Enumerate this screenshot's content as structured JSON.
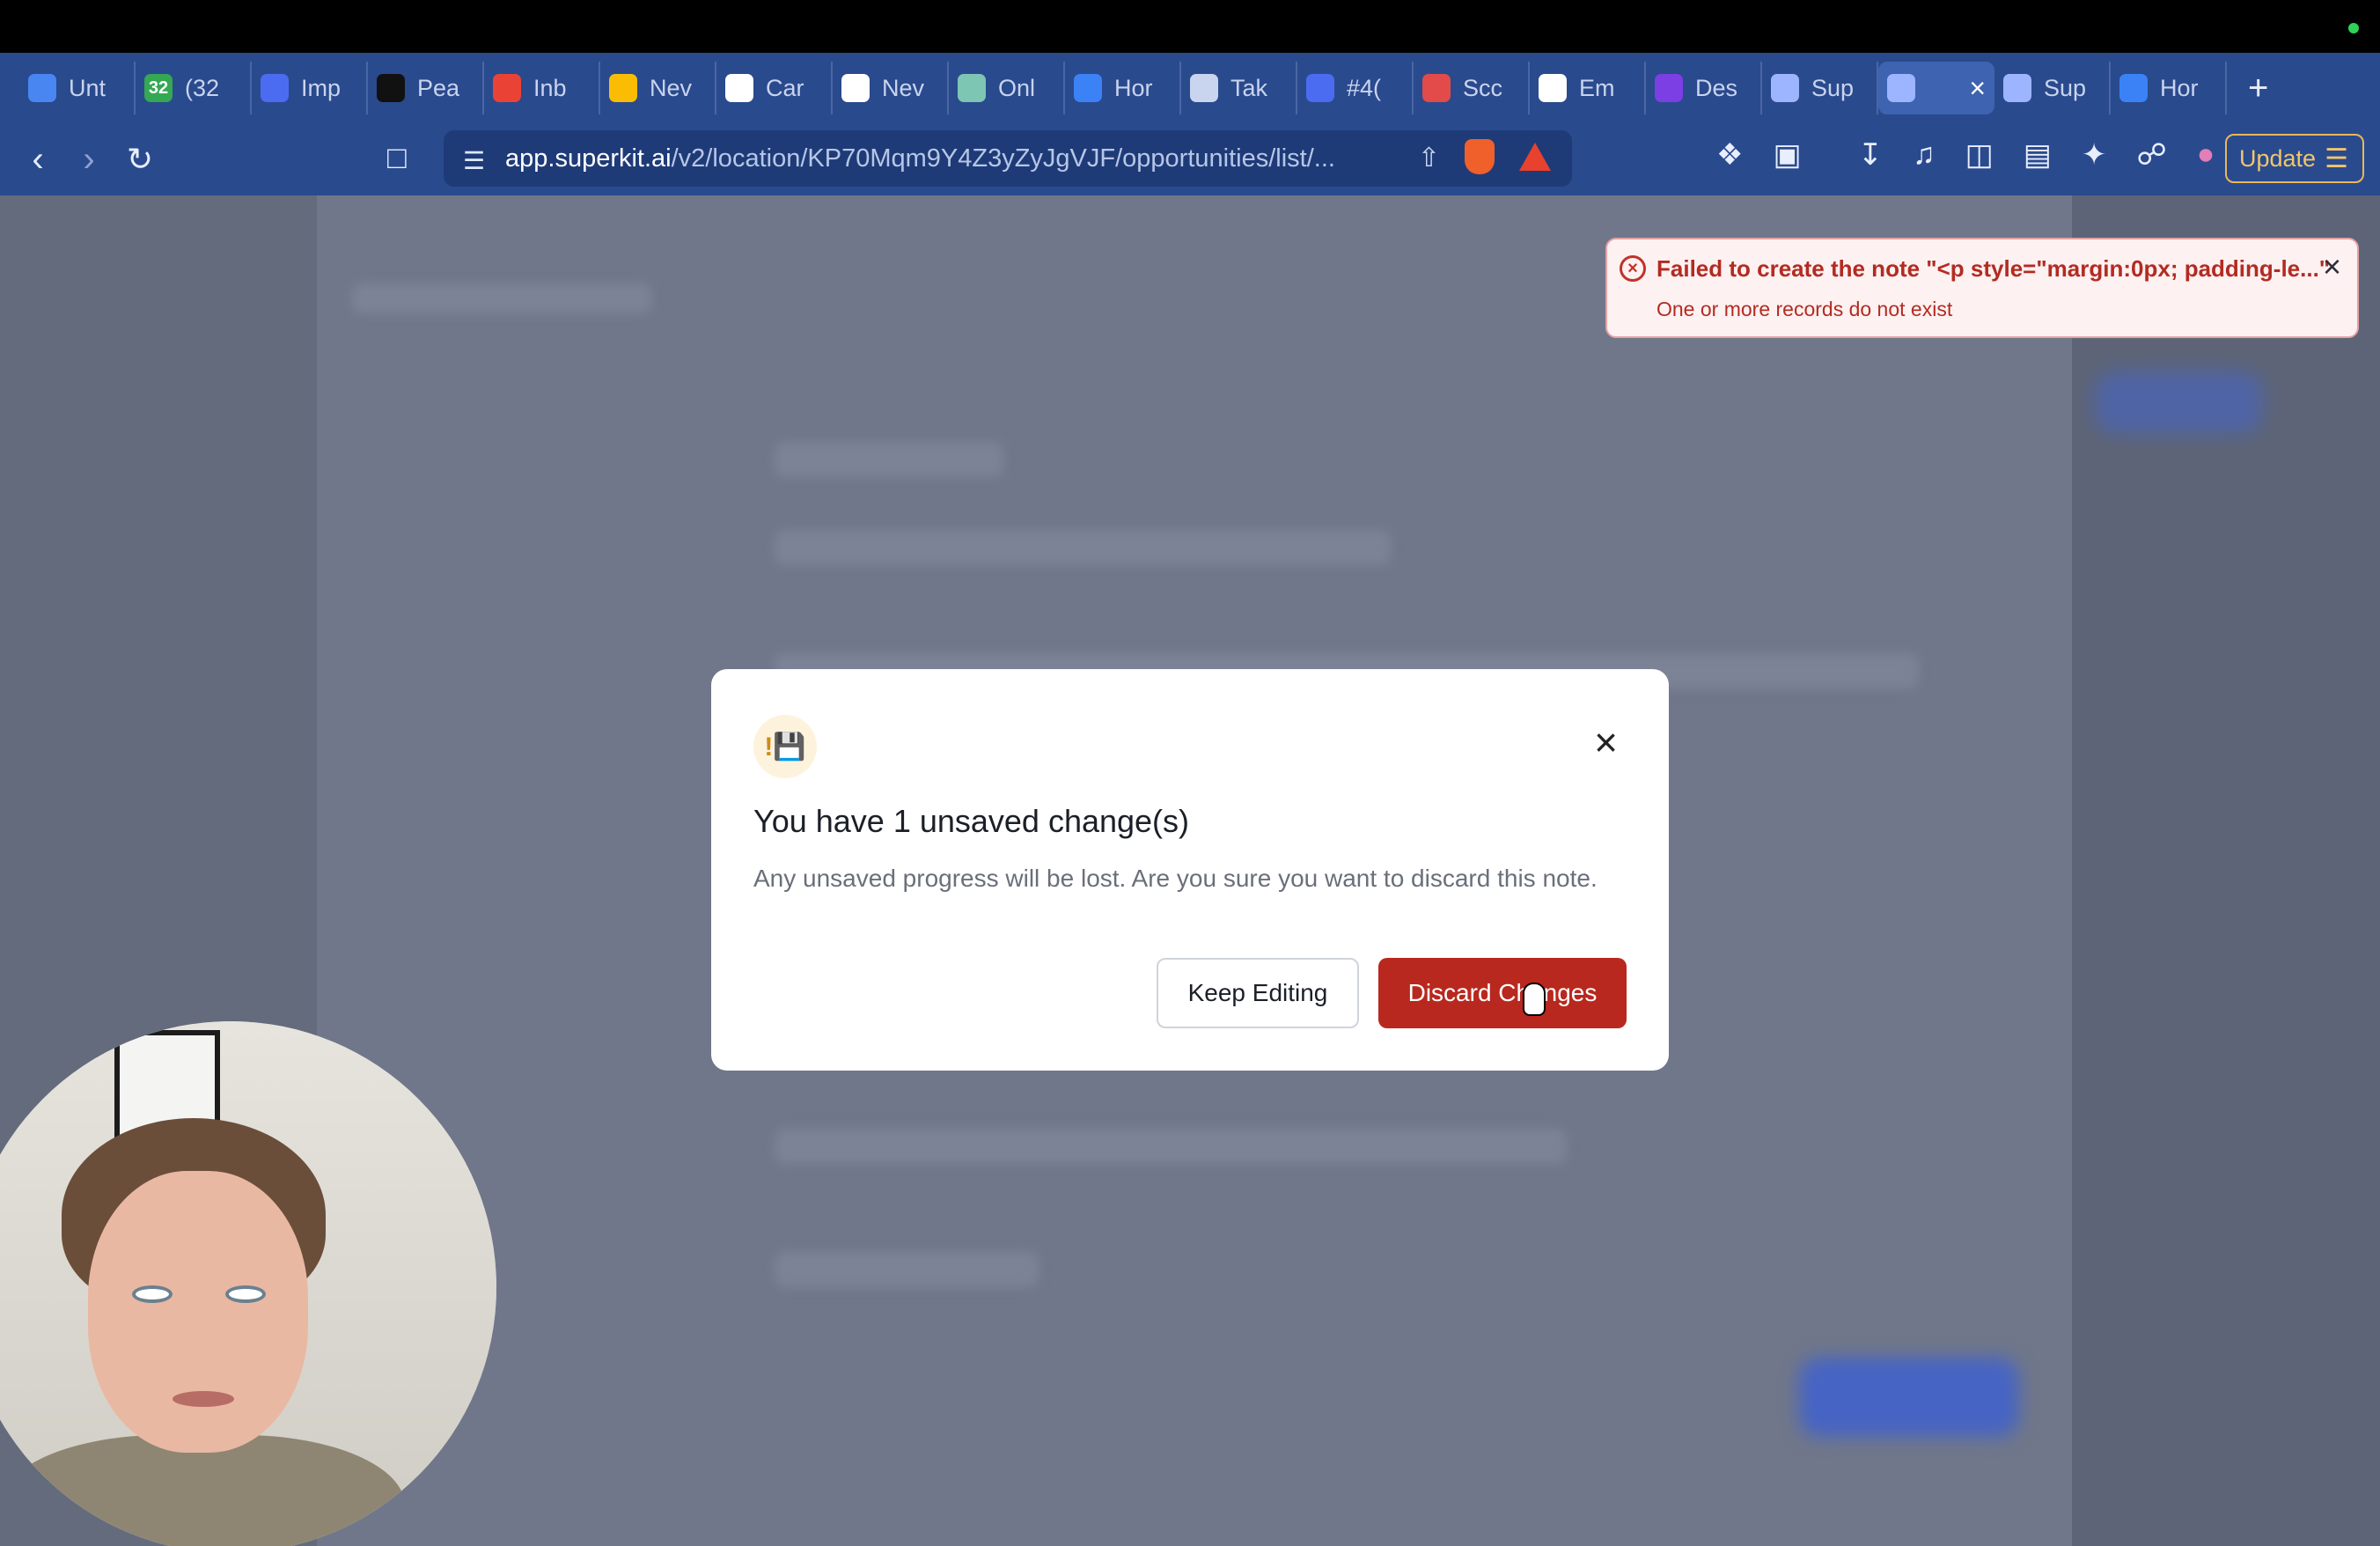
{
  "browser": {
    "tabs": [
      {
        "label": "Unt",
        "icon": "docs-icon",
        "color": "#4a86f2"
      },
      {
        "label": "(32",
        "icon": "badge-32-icon",
        "badge": "32",
        "color": "#34a853"
      },
      {
        "label": "Imp",
        "icon": "chat-icon",
        "color": "#4b6cf0"
      },
      {
        "label": "Pea",
        "icon": "framer-icon",
        "color": "#111111"
      },
      {
        "label": "Inb",
        "icon": "gmail-icon",
        "color": "#ea4335"
      },
      {
        "label": "Nev",
        "icon": "drive-icon",
        "color": "#fbbc04"
      },
      {
        "label": "Car",
        "icon": "openai-icon",
        "color": "#ffffff"
      },
      {
        "label": "Nev",
        "icon": "openai-icon",
        "color": "#ffffff"
      },
      {
        "label": "Onl",
        "icon": "grid-icon",
        "color": "#7cc6b3"
      },
      {
        "label": "Hor",
        "icon": "c-logo-icon",
        "color": "#3b82f6"
      },
      {
        "label": "Tak",
        "icon": "globe-icon",
        "color": "#c9d4ee"
      },
      {
        "label": "#4(",
        "icon": "chat-icon",
        "color": "#4b6cf0"
      },
      {
        "label": "Scc",
        "icon": "scrib-icon",
        "color": "#e34a4a"
      },
      {
        "label": "Em",
        "icon": "openai-icon",
        "color": "#ffffff"
      },
      {
        "label": "Des",
        "icon": "design-icon",
        "color": "#7b3fe4"
      },
      {
        "label": "Sup",
        "icon": "rocket-icon",
        "color": "#9db4ff"
      },
      {
        "label": "",
        "icon": "rocket-icon",
        "color": "#9db4ff",
        "active": true
      },
      {
        "label": "Sup",
        "icon": "rocket-icon",
        "color": "#9db4ff"
      },
      {
        "label": "Hor",
        "icon": "c-logo-icon",
        "color": "#3b82f6"
      }
    ],
    "new_tab": "+",
    "url_domain": "app.superkit.ai",
    "url_path": "/v2/location/KP70Mqm9Y4Z3yZyJgVJF/opportunities/list/...",
    "update_label": "Update"
  },
  "toast": {
    "title": "Failed to create the note \"<p style=\"margin:0px; padding-le...\"",
    "description": "One or more records do not exist",
    "color": "#b32b22"
  },
  "modal": {
    "icon_glyph": "!💾",
    "title": "You have 1 unsaved change(s)",
    "body": "Any unsaved progress will be lost. Are you sure you want to discard this note.",
    "keep_label": "Keep Editing",
    "discard_label": "Discard Changes",
    "discard_color": "#b8281f"
  }
}
